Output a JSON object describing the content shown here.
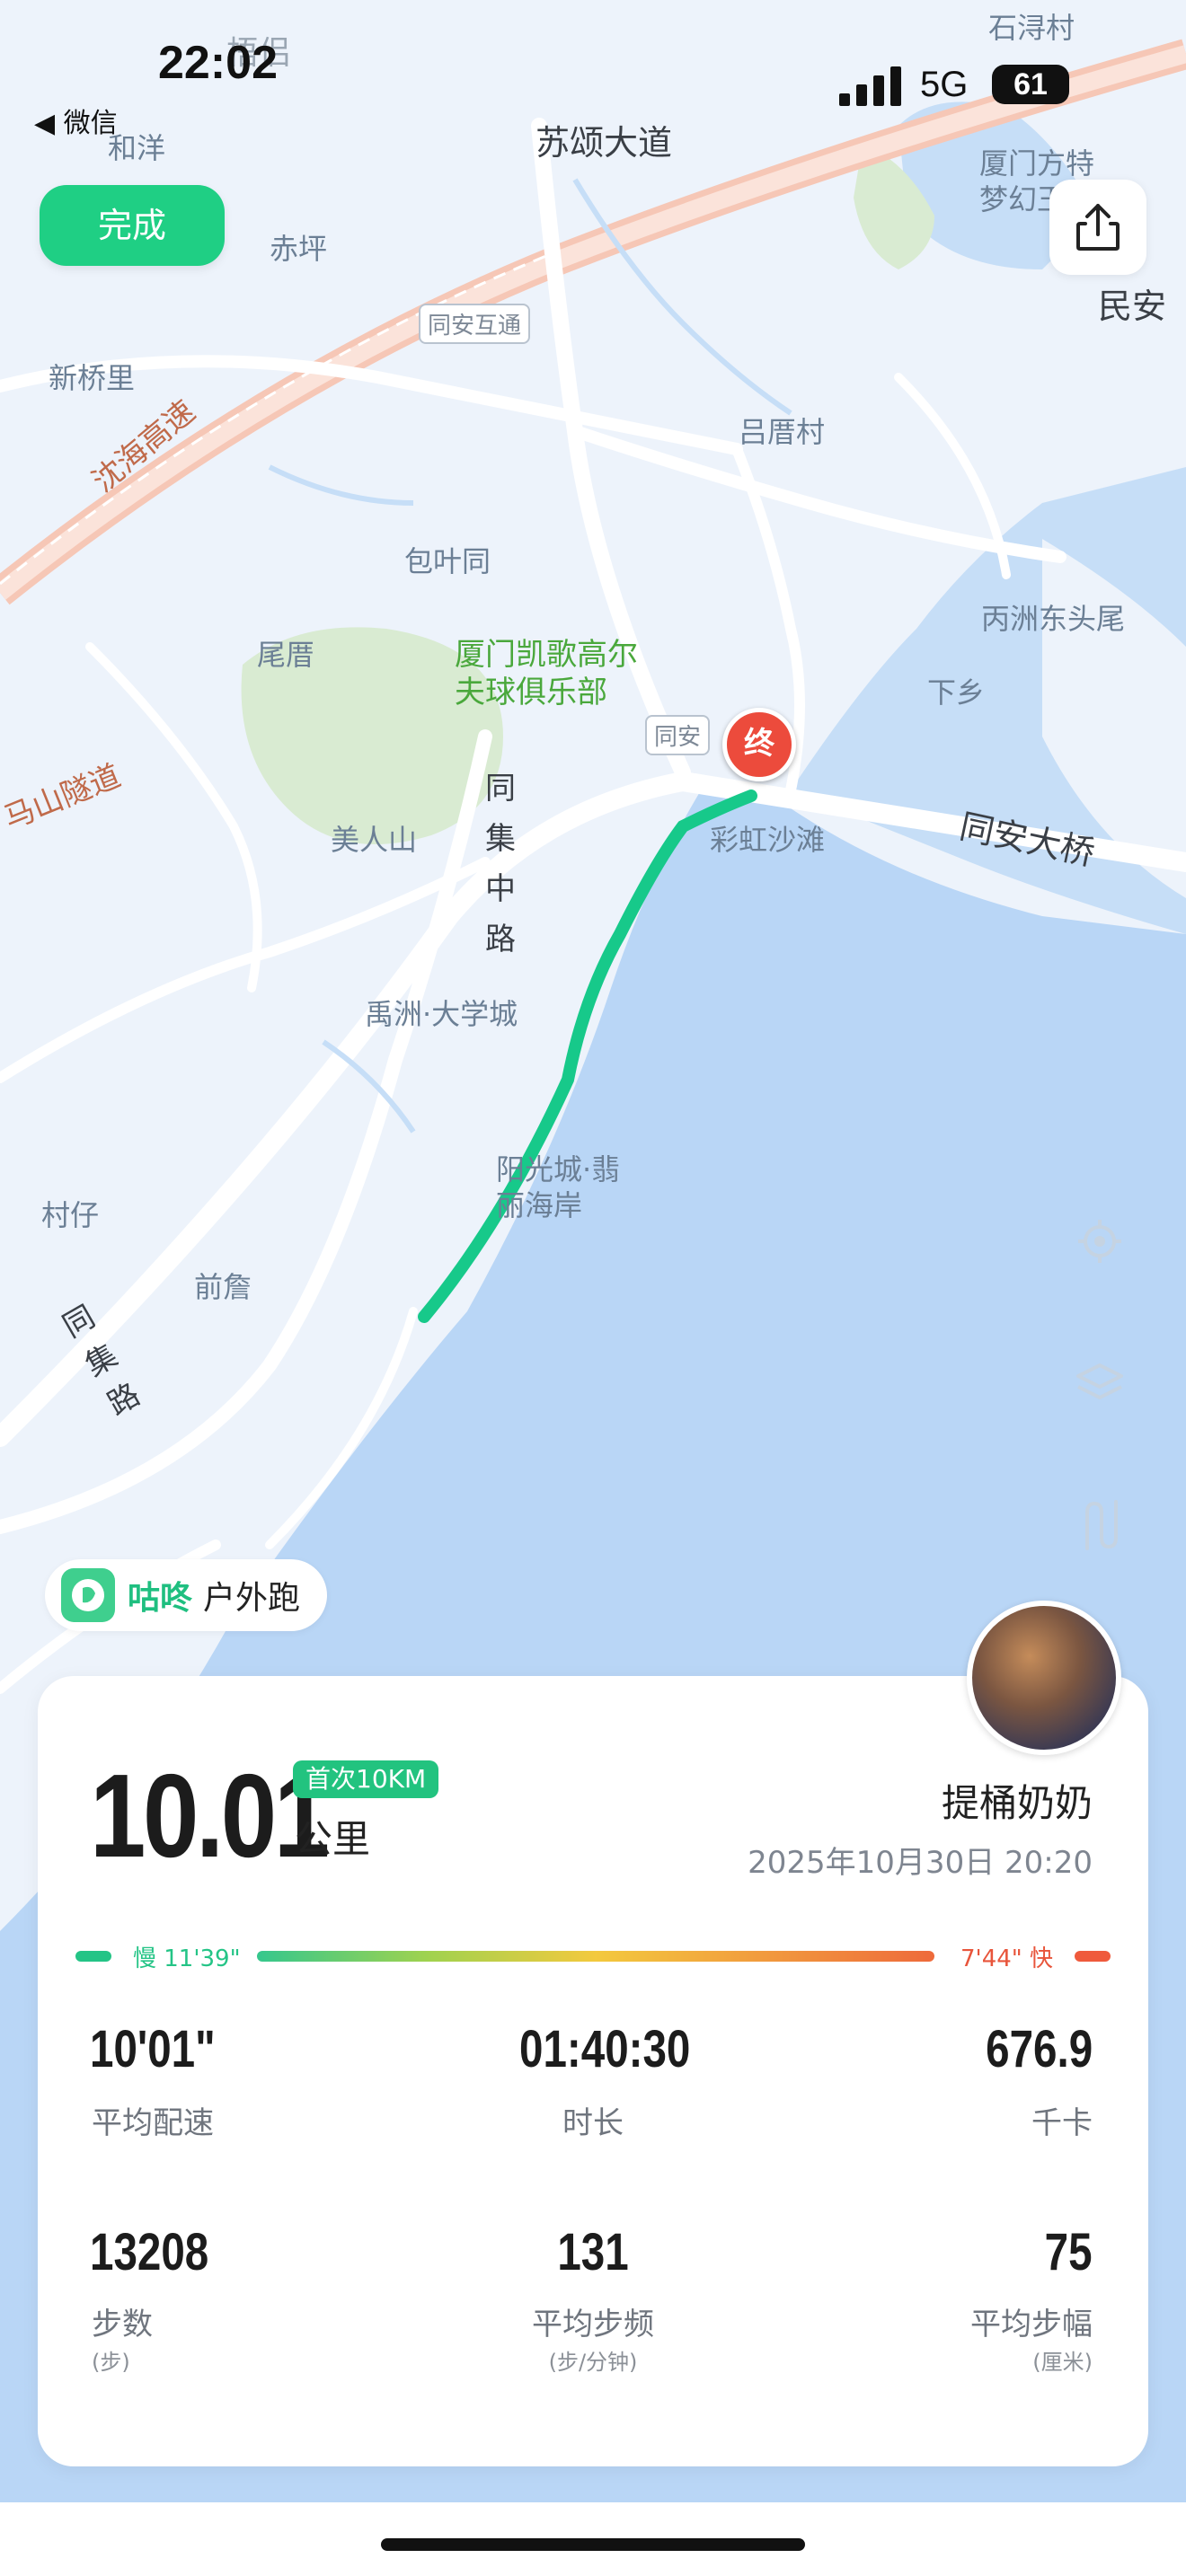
{
  "status": {
    "time": "22:02",
    "back_app": "◀ 微信",
    "network": "5G",
    "battery": "61"
  },
  "actions": {
    "done_label": "完成"
  },
  "map_labels": {
    "suming": "苏颂大道",
    "houlang": "和洋",
    "chiping": "赤坪",
    "xinqiaoli": "新桥里",
    "tongan_hutong": "同安互通",
    "lvcuocun": "吕厝村",
    "baoyetong": "包叶同",
    "weicuo": "尾厝",
    "golf": "厦门凯歌高尔\n夫球俱乐部",
    "tongji_zhonglu": "同\n集\n中\n路",
    "meirenshan": "美人山",
    "yuzhou_daxuecheng": "禹洲·大学城",
    "yangguangcheng": "阳光城·翡\n丽海岸",
    "caihong_shatan": "彩虹沙滩",
    "tongan_daqiao": "同安大桥",
    "bingzhou_dongtouwei": "丙洲东头尾",
    "xiaxiang": "下乡",
    "cunzai": "村仔",
    "qianzhan": "前詹",
    "tongji_lu": "同\n集\n路",
    "shenhai_gaosu": "沈海高速",
    "mashan_suidao": "马山隧道",
    "shixuncun": "石浔村",
    "xiamen_fangte": "厦门方特\n梦幻王",
    "minan": "民安",
    "tongan_tag": "同安",
    "qiaoju": "梧侣",
    "end_marker": "终"
  },
  "brand": {
    "name": "咕咚",
    "mode": "户外跑"
  },
  "summary": {
    "distance": "10.01",
    "badge": "首次10KM",
    "unit": "公里",
    "user": "提桶奶奶",
    "datetime": "2025年10月30日 20:20",
    "pace_slow": "慢 11'39\"",
    "pace_fast": "7'44\" 快"
  },
  "stats": [
    {
      "value": "10'01\"",
      "label": "平均配速",
      "sub": ""
    },
    {
      "value": "01:40:30",
      "label": "时长",
      "sub": ""
    },
    {
      "value": "676.9",
      "label": "千卡",
      "sub": ""
    },
    {
      "value": "13208",
      "label": "步数",
      "sub": "(步)"
    },
    {
      "value": "131",
      "label": "平均步频",
      "sub": "(步/分钟)"
    },
    {
      "value": "75",
      "label": "平均步幅",
      "sub": "(厘米)"
    }
  ],
  "colors": {
    "accent": "#1fcf84",
    "route": "#17c98a",
    "end_marker": "#ec4b3c"
  },
  "icons": {
    "share": "share-icon",
    "locate": "locate-icon",
    "layers": "layers-icon",
    "route": "route-icon"
  }
}
